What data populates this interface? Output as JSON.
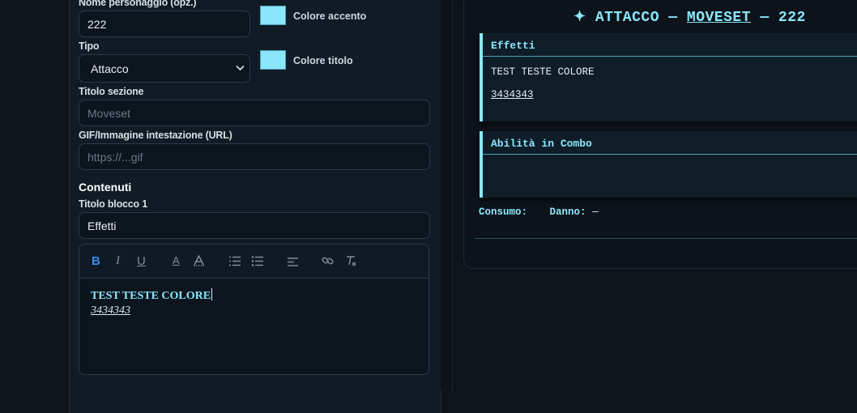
{
  "form": {
    "character_name": {
      "label": "Nome personaggio (opz.)",
      "value": "222"
    },
    "accent_color": {
      "label": "Colore accento",
      "value": "#8be6fb"
    },
    "title_color": {
      "label": "Colore titolo",
      "value": "#8be6fb"
    },
    "type": {
      "label": "Tipo",
      "value": "Attacco"
    },
    "section_title": {
      "label": "Titolo sezione",
      "placeholder": "Moveset"
    },
    "header_image": {
      "label": "GIF/Immagine intestazione (URL)",
      "placeholder": "https://...gif"
    },
    "contents_heading": "Contenuti",
    "block1_title": {
      "label": "Titolo blocco 1",
      "value": "Effetti"
    },
    "editor": {
      "toolbar": [
        "bold-icon",
        "italic-icon",
        "underline-icon",
        "text-color-icon",
        "highlight-icon",
        "ordered-list-icon",
        "bullet-list-icon",
        "align-icon",
        "link-icon",
        "clear-format-icon"
      ],
      "line1": "TEST TESTE COLORE",
      "line2": "3434343"
    }
  },
  "preview": {
    "title_prefix": "✦ ATTACCO — ",
    "title_link": "MOVESET",
    "title_suffix": " — 222",
    "blocks": [
      {
        "title": "Effetti",
        "lines": [
          "TEST TESTE COLORE",
          "3434343"
        ]
      },
      {
        "title": "Abilità in Combo",
        "lines": []
      }
    ],
    "footer": {
      "consumo_label": "Consumo:",
      "consumo_value": "",
      "danno_label": "Danno:",
      "danno_value": "—"
    }
  }
}
